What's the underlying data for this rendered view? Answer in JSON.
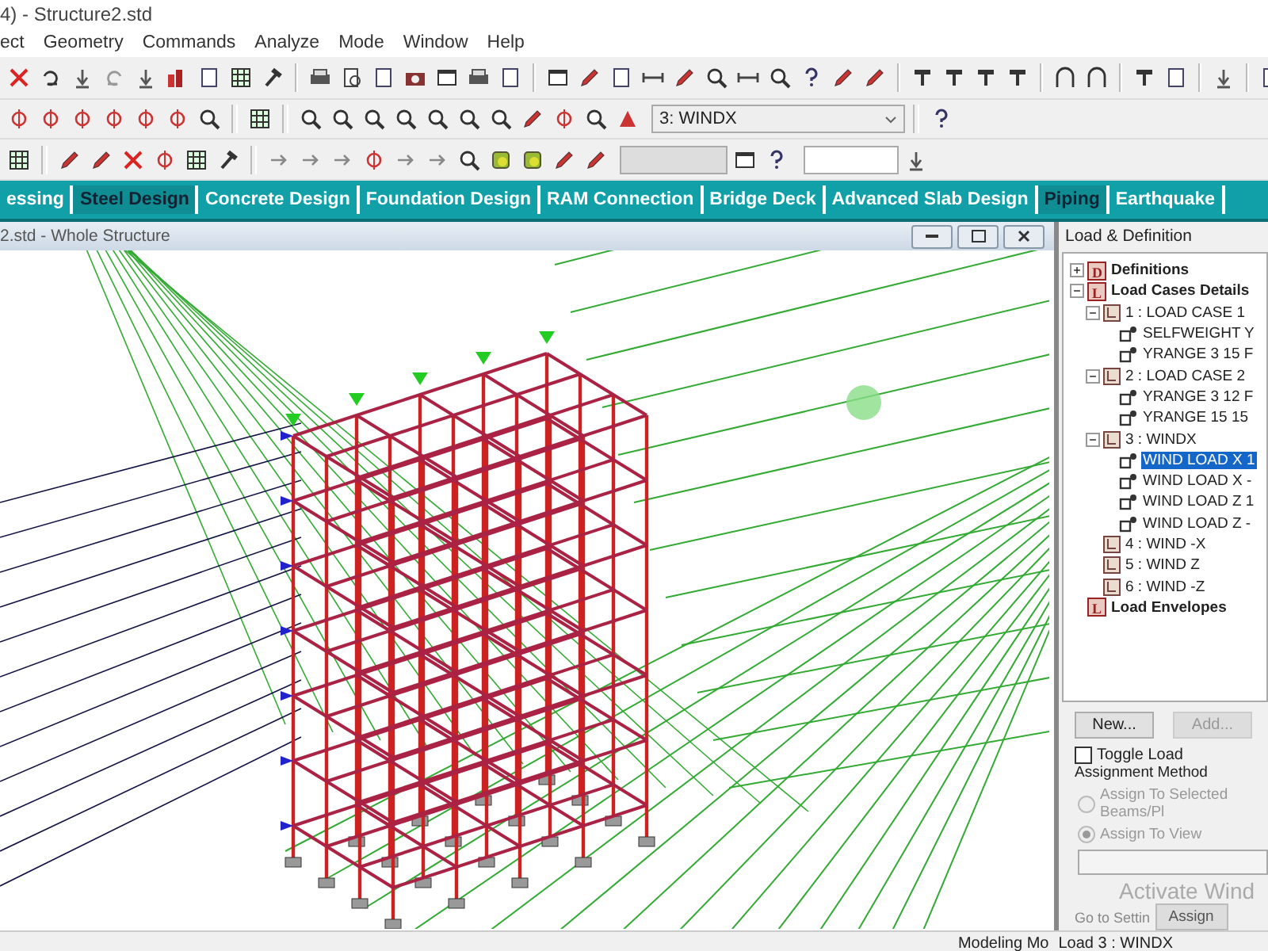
{
  "window": {
    "title": "4) - Structure2.std"
  },
  "menu": [
    "ect",
    "Geometry",
    "Commands",
    "Analyze",
    "Mode",
    "Window",
    "Help"
  ],
  "toolbar": {
    "load_case_dropdown": {
      "value": "3: WINDX"
    },
    "disabled_dropdown": {
      "disabled": true
    }
  },
  "tabs": [
    {
      "label": "essing",
      "selected": false
    },
    {
      "label": "Steel Design",
      "selected": true
    },
    {
      "label": "Concrete Design",
      "selected": false
    },
    {
      "label": "Foundation Design",
      "selected": false
    },
    {
      "label": "RAM Connection",
      "selected": false
    },
    {
      "label": "Bridge Deck",
      "selected": false
    },
    {
      "label": "Advanced Slab Design",
      "selected": false
    },
    {
      "label": "Piping",
      "selected": true
    },
    {
      "label": "Earthquake",
      "selected": false
    }
  ],
  "viewport": {
    "title": "2.std - Whole Structure"
  },
  "panel": {
    "title": "Load & Definition",
    "tree": [
      {
        "label": "Definitions",
        "kind": "group",
        "letter": "D",
        "expanded": false,
        "selected": false
      },
      {
        "label": "Load Cases Details",
        "kind": "group",
        "letter": "L",
        "expanded": true,
        "selected": false,
        "children": [
          {
            "label": "1 : LOAD CASE 1",
            "kind": "case",
            "expanded": true,
            "selected": false,
            "children": [
              {
                "label": "SELFWEIGHT Y",
                "kind": "load",
                "selected": false
              },
              {
                "label": "YRANGE 3 15 F",
                "kind": "load",
                "selected": false
              }
            ]
          },
          {
            "label": "2 : LOAD CASE 2",
            "kind": "case",
            "expanded": true,
            "selected": false,
            "children": [
              {
                "label": "YRANGE 3 12 F",
                "kind": "load",
                "selected": false
              },
              {
                "label": "YRANGE 15 15",
                "kind": "load",
                "selected": false
              }
            ]
          },
          {
            "label": "3 : WINDX",
            "kind": "case",
            "expanded": true,
            "selected": false,
            "children": [
              {
                "label": "WIND LOAD X 1",
                "kind": "load",
                "selected": true
              },
              {
                "label": "WIND LOAD X -",
                "kind": "load",
                "selected": false
              },
              {
                "label": "WIND LOAD Z 1",
                "kind": "load",
                "selected": false
              },
              {
                "label": "WIND LOAD Z -",
                "kind": "load",
                "selected": false
              }
            ]
          },
          {
            "label": "4 : WIND -X",
            "kind": "case",
            "selected": false
          },
          {
            "label": "5 : WIND Z",
            "kind": "case",
            "selected": false
          },
          {
            "label": "6 : WIND -Z",
            "kind": "case",
            "selected": false
          }
        ]
      },
      {
        "label": "Load Envelopes",
        "kind": "group",
        "letter": "L",
        "selected": false
      }
    ],
    "buttons": [
      {
        "label": "New...",
        "disabled": false
      },
      {
        "label": "Add...",
        "disabled": true
      }
    ],
    "toggle_load": {
      "label": "Toggle Load",
      "checked": false
    },
    "assignment_method": {
      "label": "Assignment Method",
      "options": [
        {
          "label": "Assign To Selected Beams/Pl",
          "selected": false,
          "disabled": true
        },
        {
          "label": "Assign To View",
          "selected": true,
          "disabled": true
        }
      ]
    },
    "assign_button": {
      "label": "Assign"
    },
    "activation_notice": [
      "Activate Wind",
      "Go to Settin"
    ]
  },
  "status_bar": [
    "Modeling Mo",
    "Load 3 : WINDX"
  ]
}
